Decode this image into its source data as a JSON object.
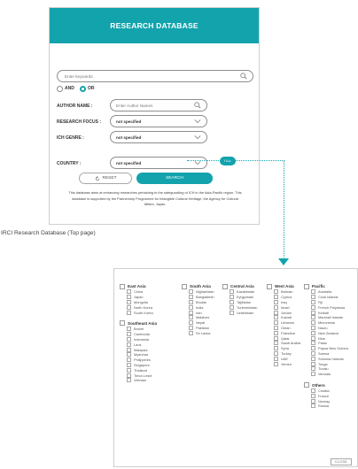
{
  "colors": {
    "accent": "#12a3ad",
    "border": "#8e8e8e"
  },
  "panel": {
    "title": "RESEARCH DATABASE",
    "keyword_placeholder": "Enter keywords",
    "keyword_icon": "search-icon",
    "radio_and": "AND",
    "radio_or": "OR",
    "selected_operator": "OR",
    "author_label": "AUTHOR NAME :",
    "author_placeholder": "Enter Author Names",
    "focus_label": "RESEARCH FOCUS :",
    "focus_value": "not specified",
    "genre_label": "ICH GENRE :",
    "genre_value": "not specified",
    "country_label": "COUNTRY :",
    "country_value": "not specified",
    "hide_label": "Hide",
    "reset_label": "RESET",
    "search_label": "SEARCH",
    "description": "This database aims at enhancing researches pertaining to the safeguarding of ICH in the Asia-Pacific region. This database is supported by the Partnership Programme for Intangible Cultural Heritage, the Agency for Cultural Affairs, Japan."
  },
  "caption": "IRCI Research Database (Top page)",
  "popup": {
    "groups": [
      {
        "name": "East Asia",
        "countries": [
          "China",
          "Japan",
          "Mongolia",
          "North Korea",
          "South Korea"
        ]
      },
      {
        "name": "Southeast Asia",
        "countries": [
          "Brunei",
          "Cambodia",
          "Indonesia",
          "Laos",
          "Malaysia",
          "Myanmar",
          "Philippines",
          "Singapore",
          "Thailand",
          "Timor-Leste",
          "Vietnam"
        ]
      },
      {
        "name": "South Asia",
        "countries": [
          "Afghanistan",
          "Bangladesh",
          "Bhutan",
          "India",
          "Iran",
          "Maldives",
          "Nepal",
          "Pakistan",
          "Sri Lanka"
        ]
      },
      {
        "name": "Central Asia",
        "countries": [
          "Kazakhstan",
          "Kyrgyzstan",
          "Tajikistan",
          "Turkmenistan",
          "Uzbekistan"
        ]
      },
      {
        "name": "West Asia",
        "countries": [
          "Bahrain",
          "Cyprus",
          "Iraq",
          "Israel",
          "Jordan",
          "Kuwait",
          "Lebanon",
          "Oman",
          "Palestine",
          "Qatar",
          "Saudi Arabia",
          "Syria",
          "Turkey",
          "UAE",
          "Yemen"
        ]
      },
      {
        "name": "Pacific",
        "countries": [
          "Australia",
          "Cook Islands",
          "Fiji",
          "French Polynesia",
          "Kiribati",
          "Marshall Islands",
          "Micronesia",
          "Nauru",
          "New Zealand",
          "Niue",
          "Palau",
          "Papua New Guinea",
          "Samoa",
          "Solomon Islands",
          "Tonga",
          "Tuvalu",
          "Vanuatu"
        ]
      },
      {
        "name": "Others",
        "countries": [
          "Croatia",
          "France",
          "Norway",
          "Russia"
        ]
      }
    ],
    "close_label": "CLOSE"
  }
}
